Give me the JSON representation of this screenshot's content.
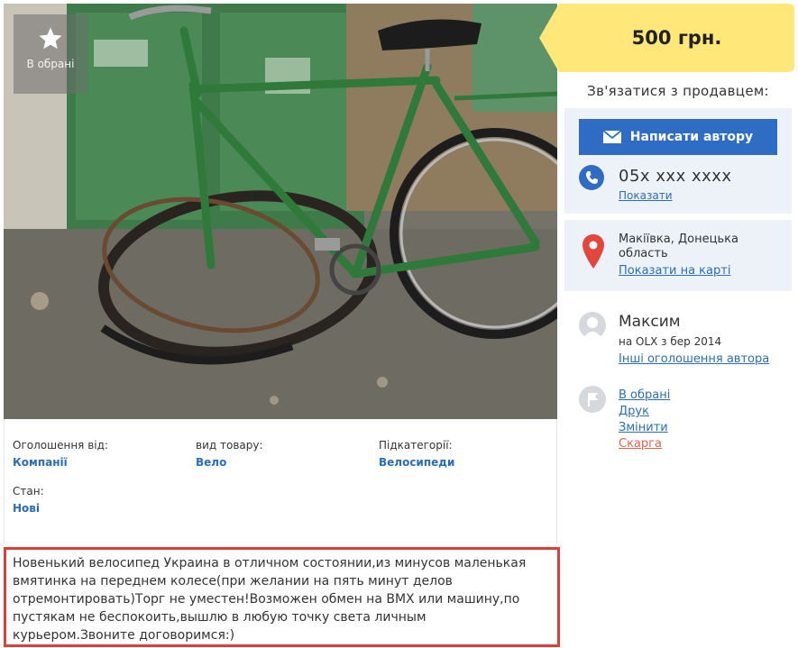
{
  "favorite": {
    "label": "В обрані",
    "icon": "star-icon"
  },
  "price": {
    "text": "500 грн."
  },
  "contact": {
    "title": "Зв'язатися з продавцем:",
    "write_button": "Написати автору",
    "phone": "05x xxx xxxx",
    "show_phone": "Показати"
  },
  "location": {
    "text": "Макіївка, Донецька область",
    "map_link": "Показати на карті"
  },
  "seller": {
    "name": "Максим",
    "since": "на OLX з бер 2014",
    "other_ads": "Інші оголошення автора"
  },
  "actions": [
    {
      "label": "В обрані"
    },
    {
      "label": "Друк"
    },
    {
      "label": "Змінити"
    },
    {
      "label": "Скарга"
    }
  ],
  "attributes": [
    {
      "key": "Оголошення від:",
      "value": "Компанії"
    },
    {
      "key": "вид товару:",
      "value": "Вело"
    },
    {
      "key": "Підкатегорії:",
      "value": "Велосипеди"
    },
    {
      "key": "Стан:",
      "value": "Нові"
    }
  ],
  "description": "Новенький велосипед Украина в отличном состоянии,из минусов маленькая вмятинка на переднем колесе(при желании на пять минут делов отремонтировать)Торг не уместен!Возможен обмен на BMX или машину,по пустякам не беспокоить,вышлю в любую точку света личным курьером.Звоните договоримся:)",
  "colors": {
    "accent": "#2f6dc4",
    "price_bg": "#ffe77a",
    "highlight_border": "#d9403a",
    "link": "#2a6eb8"
  }
}
